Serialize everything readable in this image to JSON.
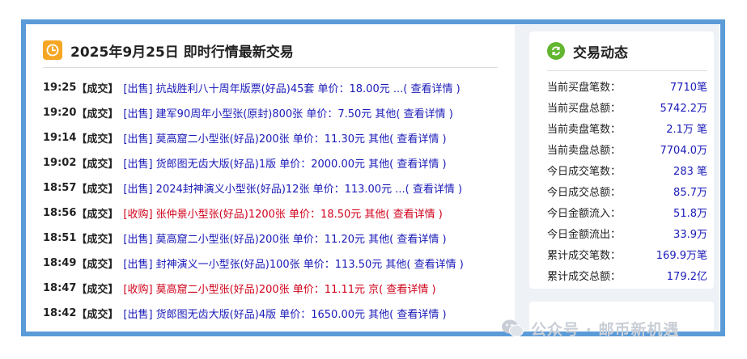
{
  "left": {
    "title": "2025年9月25日 即时行情最新交易",
    "icon": "clock-icon",
    "trades": [
      {
        "time": "19:25",
        "status": "【成交】",
        "text": "[出售] 抗战胜利八十周年版票(好品)45套 单价：18.00元 ...",
        "link": "( 查看详情 )",
        "type": "sell"
      },
      {
        "time": "19:20",
        "status": "【成交】",
        "text": "[出售] 建军90周年小型张(原封)800张 单价：7.50元 其他",
        "link": "( 查看详情 )",
        "type": "sell"
      },
      {
        "time": "19:14",
        "status": "【成交】",
        "text": "[出售] 莫高窟二小型张(好品)200张 单价：11.30元 其他",
        "link": "( 查看详情 )",
        "type": "sell"
      },
      {
        "time": "19:02",
        "status": "【成交】",
        "text": "[出售] 货郎图无齿大版(好品)1版 单价：2000.00元 其他",
        "link": "( 查看详情 )",
        "type": "sell"
      },
      {
        "time": "18:57",
        "status": "【成交】",
        "text": "[出售] 2024封神演义小型张(好品)12张 单价：113.00元 ...",
        "link": "( 查看详情 )",
        "type": "sell"
      },
      {
        "time": "18:56",
        "status": "【成交】",
        "text": "[收购] 张仲景小型张(好品)1200张 单价：18.50元 其他",
        "link": "( 查看详情 )",
        "type": "buy"
      },
      {
        "time": "18:51",
        "status": "【成交】",
        "text": "[出售] 莫高窟二小型张(好品)200张 单价：11.20元 其他",
        "link": "( 查看详情 )",
        "type": "sell"
      },
      {
        "time": "18:49",
        "status": "【成交】",
        "text": "[出售] 封神演义一小型张(好品)100张 单价：113.50元 其他",
        "link": "( 查看详情 )",
        "type": "sell"
      },
      {
        "time": "18:47",
        "status": "【成交】",
        "text": "[收购] 莫高窟二小型张(好品)200张 单价：11.11元 京",
        "link": "( 查看详情 )",
        "type": "buy"
      },
      {
        "time": "18:42",
        "status": "【成交】",
        "text": "[出售] 货郎图无齿大版(好品)4版 单价：1650.00元 其他",
        "link": "( 查看详情 )",
        "type": "sell"
      }
    ]
  },
  "right": {
    "title": "交易动态",
    "icon": "refresh-icon",
    "stats": [
      {
        "label": "当前买盘笔数：",
        "value": "7710笔"
      },
      {
        "label": "当前买盘总额：",
        "value": "5742.2万"
      },
      {
        "label": "当前卖盘笔数：",
        "value": "2.1万 笔"
      },
      {
        "label": "当前卖盘总额：",
        "value": "7704.0万"
      },
      {
        "label": "今日成交笔数：",
        "value": "283 笔"
      },
      {
        "label": "今日成交总额：",
        "value": "85.7万"
      },
      {
        "label": "今日金额流入：",
        "value": "51.8万"
      },
      {
        "label": "今日金额流出：",
        "value": "33.9万"
      },
      {
        "label": "累计成交笔数：",
        "value": "169.9万笔"
      },
      {
        "label": "累计成交总额：",
        "value": "179.2亿"
      }
    ]
  },
  "watermark": {
    "text": "公众号 · 邮币新机遇",
    "icon": "wechat-icon"
  },
  "colors": {
    "frame": "#5b9bd8",
    "sell": "#1a1ab8",
    "buy": "#d0021b",
    "clock": "#f5a623",
    "refresh": "#62b630"
  }
}
